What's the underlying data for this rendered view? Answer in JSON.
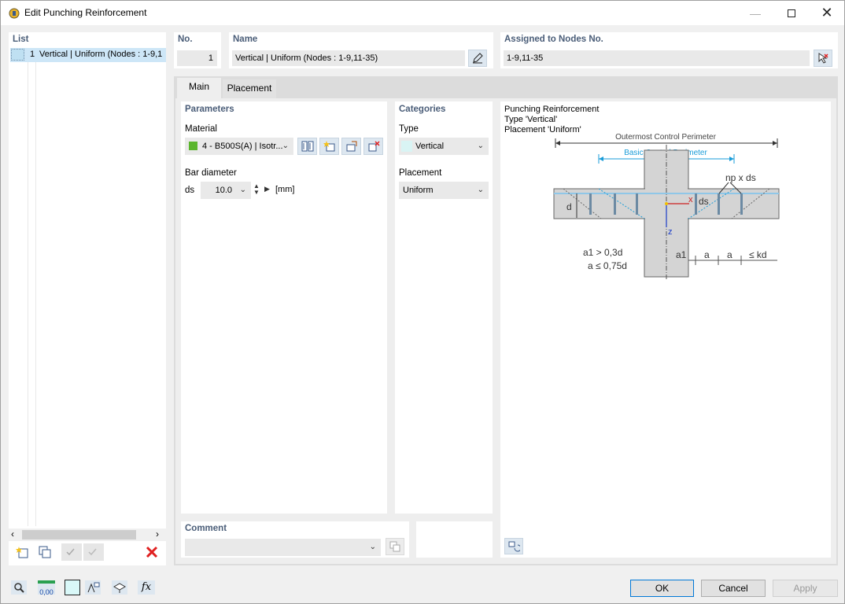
{
  "window": {
    "title": "Edit Punching Reinforcement"
  },
  "list": {
    "header": "List",
    "items": [
      {
        "no": "1",
        "label": "Vertical | Uniform (Nodes : 1-9,1"
      }
    ]
  },
  "no": {
    "header": "No.",
    "value": "1"
  },
  "name": {
    "header": "Name",
    "value": "Vertical | Uniform (Nodes : 1-9,11-35)"
  },
  "assigned": {
    "header": "Assigned to Nodes No.",
    "value": "1-9,11-35"
  },
  "tabs": [
    {
      "label": "Main"
    },
    {
      "label": "Placement"
    }
  ],
  "parameters": {
    "header": "Parameters",
    "material_label": "Material",
    "material_value": "4 - B500S(A) | Isotr...",
    "material_color": "#5ab52c",
    "bar_diameter_label": "Bar diameter",
    "symbol": "ds",
    "bar_diameter_value": "10.0",
    "unit": "[mm]"
  },
  "categories": {
    "header": "Categories",
    "type_label": "Type",
    "type_value": "Vertical",
    "type_color": "#d9f4f4",
    "placement_label": "Placement",
    "placement_value": "Uniform"
  },
  "diagram": {
    "line1": "Punching Reinforcement",
    "line2": "Type 'Vertical'",
    "line3": "Placement 'Uniform'",
    "outer_label": "Outermost Control Perimeter",
    "basic_label": "Basic Control Perimeter",
    "np_label": "np x ds",
    "ds_label": "ds",
    "d_label": "d",
    "x_label": "x",
    "z_label": "z",
    "a1_label": "a1",
    "a_label": "a",
    "kd_label": "≤ kd",
    "formula1": "a1 > 0,3d",
    "formula2": "a ≤ 0,75d"
  },
  "comment": {
    "header": "Comment",
    "value": ""
  },
  "buttons": {
    "ok": "OK",
    "cancel": "Cancel",
    "apply": "Apply"
  },
  "status_icons": {
    "value_icon_text": "0,00"
  }
}
